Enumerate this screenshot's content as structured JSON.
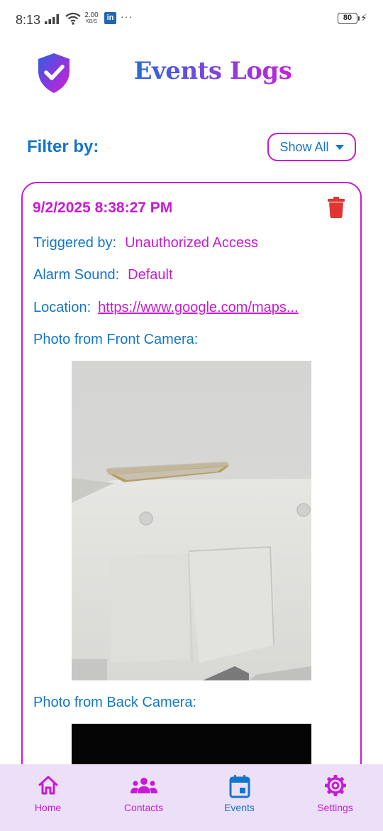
{
  "status_bar": {
    "time": "8:13",
    "net_speed_value": "2.00",
    "net_speed_unit": "KB/S",
    "notification_app": "in",
    "more": "···",
    "battery": "80"
  },
  "header": {
    "title": "Events Logs"
  },
  "filter": {
    "label": "Filter by:",
    "selected": "Show All"
  },
  "event": {
    "datetime": "9/2/2025 8:38:27 PM",
    "triggered_label": "Triggered by:",
    "triggered_value": "Unauthorized Access",
    "sound_label": "Alarm Sound:",
    "sound_value": "Default",
    "location_label": "Location:",
    "location_value": "https://www.google.com/maps...",
    "front_label": "Photo from Front Camera:",
    "back_label": "Photo from Back Camera:"
  },
  "nav": {
    "items": [
      {
        "label": "Home",
        "icon": "home-icon"
      },
      {
        "label": "Contacts",
        "icon": "contacts-icon"
      },
      {
        "label": "Events",
        "icon": "calendar-icon"
      },
      {
        "label": "Settings",
        "icon": "gear-icon"
      }
    ],
    "active": "Events"
  },
  "colors": {
    "primary_blue": "#1276c9",
    "accent_magenta": "#c81ad4",
    "delete_red": "#e03530",
    "nav_background": "#ece0f8"
  }
}
